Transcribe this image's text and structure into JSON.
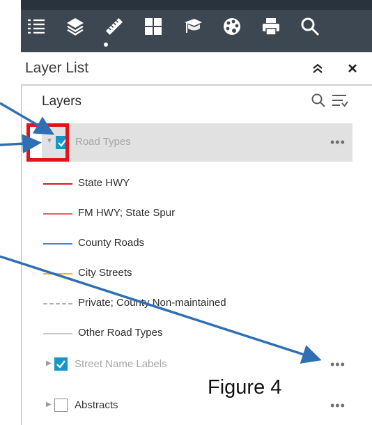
{
  "toolbar": {
    "icons": [
      "list-icon",
      "layers-icon",
      "ruler-icon",
      "grid-icon",
      "graduation-cap-icon",
      "palette-icon",
      "print-icon",
      "search-icon"
    ],
    "active": "layers-icon",
    "bg_color": "#3d4751"
  },
  "panel": {
    "title": "Layer List",
    "collapse_icon": "double-chevron-up-icon",
    "close_icon": "close-icon"
  },
  "layers_section": {
    "title": "Layers",
    "search_icon": "search-icon",
    "filter_icon": "filter-list-icon"
  },
  "layers": [
    {
      "label": "Road Types",
      "checked": true,
      "expanded": true,
      "selected": true,
      "more": "•••",
      "legend": [
        {
          "label": "State HWY",
          "color": "#e3141c",
          "style": "solid"
        },
        {
          "label": "FM HWY; State Spur",
          "color": "#ef5c5c",
          "style": "solid"
        },
        {
          "label": "County Roads",
          "color": "#4a86d8",
          "style": "solid"
        },
        {
          "label": "City Streets",
          "color": "#f4b531",
          "style": "solid"
        },
        {
          "label": "Private; County Non-maintained",
          "color": "#b2b2b2",
          "style": "dashed"
        },
        {
          "label": "Other Road Types",
          "color": "#c9c9c9",
          "style": "solid"
        }
      ]
    },
    {
      "label": "Street Name Labels",
      "checked": true,
      "expanded": false,
      "more": "•••"
    },
    {
      "label": "Abstracts",
      "checked": false,
      "expanded": false,
      "more": "•••"
    }
  ],
  "annotation": {
    "figure_label": "Figure 4",
    "highlight_color": "#e1141c",
    "arrow_color": "#2f6fb3"
  }
}
